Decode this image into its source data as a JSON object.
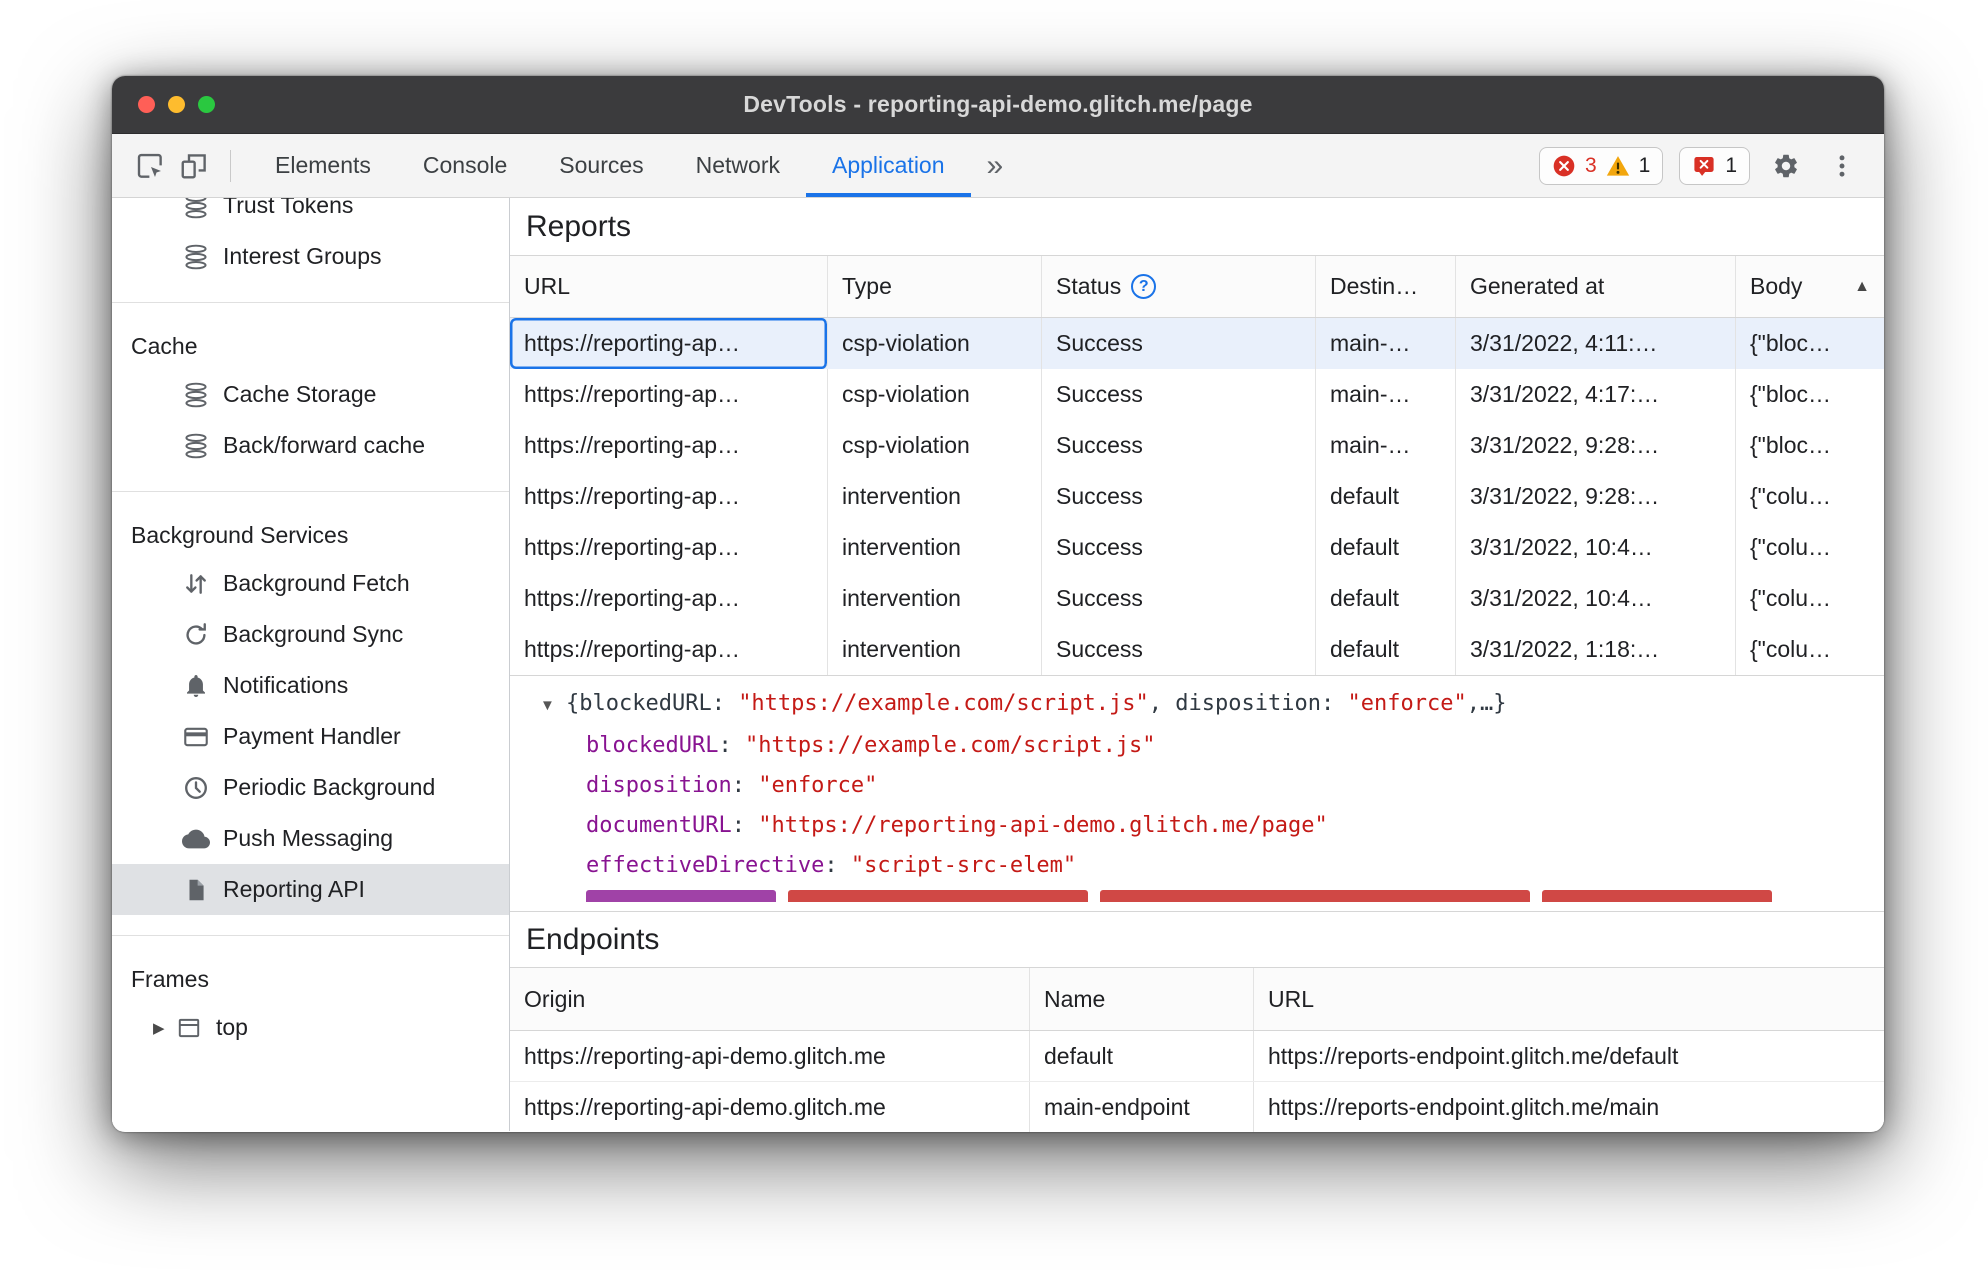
{
  "window": {
    "title": "DevTools - reporting-api-demo.glitch.me/page"
  },
  "icons": {
    "more_tabs": "»",
    "help": "?",
    "sort_asc": "▲",
    "expander": "▼",
    "disclosure": "▶"
  },
  "colors": {
    "accent": "#1a73e8",
    "error": "#d93025",
    "warning": "#f2a60d",
    "json_key": "#881391",
    "json_string": "#c41a16",
    "selected_row": "#e9f0fb",
    "titlebar": "#3b3b3d"
  },
  "toolbar": {
    "tabs": [
      "Elements",
      "Console",
      "Sources",
      "Network",
      "Application"
    ],
    "active_tab": "Application",
    "errors_count": "3",
    "warnings_count": "1",
    "issues_count": "1"
  },
  "sidebar": {
    "items": [
      "Trust Tokens",
      "Interest Groups",
      "Cache",
      "Cache Storage",
      "Back/forward cache",
      "Background Services",
      "Background Fetch",
      "Background Sync",
      "Notifications",
      "Payment Handler",
      "Periodic Background",
      "Push Messaging",
      "Reporting API",
      "Frames",
      "top"
    ],
    "selected_item": "Reporting API"
  },
  "reports": {
    "heading": "Reports",
    "columns": {
      "url": "URL",
      "type": "Type",
      "status": "Status",
      "destination": "Destin…",
      "generated": "Generated at",
      "body": "Body"
    },
    "rows": [
      {
        "url": "https://reporting-ap…",
        "type": "csp-violation",
        "status": "Success",
        "destination": "main-…",
        "generated": "3/31/2022, 4:11:…",
        "body": "{\"bloc…"
      },
      {
        "url": "https://reporting-ap…",
        "type": "csp-violation",
        "status": "Success",
        "destination": "main-…",
        "generated": "3/31/2022, 4:17:…",
        "body": "{\"bloc…"
      },
      {
        "url": "https://reporting-ap…",
        "type": "csp-violation",
        "status": "Success",
        "destination": "main-…",
        "generated": "3/31/2022, 9:28:…",
        "body": "{\"bloc…"
      },
      {
        "url": "https://reporting-ap…",
        "type": "intervention",
        "status": "Success",
        "destination": "default",
        "generated": "3/31/2022, 9:28:…",
        "body": "{\"colu…"
      },
      {
        "url": "https://reporting-ap…",
        "type": "intervention",
        "status": "Success",
        "destination": "default",
        "generated": "3/31/2022, 10:4…",
        "body": "{\"colu…"
      },
      {
        "url": "https://reporting-ap…",
        "type": "intervention",
        "status": "Success",
        "destination": "default",
        "generated": "3/31/2022, 10:4…",
        "body": "{\"colu…"
      },
      {
        "url": "https://reporting-ap…",
        "type": "intervention",
        "status": "Success",
        "destination": "default",
        "generated": "3/31/2022, 1:18:…",
        "body": "{\"colu…"
      }
    ]
  },
  "preview": {
    "colon": ": ",
    "summary": [
      {
        "t": "{blockedURL: "
      },
      {
        "t": "\"https://example.com/script.js\""
      },
      {
        "t": ", disposition: "
      },
      {
        "t": "\"enforce\""
      },
      {
        "t": ",…}"
      }
    ],
    "properties": [
      {
        "key": "blockedURL",
        "value": "\"https://example.com/script.js\""
      },
      {
        "key": "disposition",
        "value": "\"enforce\""
      },
      {
        "key": "documentURL",
        "value": "\"https://reporting-api-demo.glitch.me/page\""
      },
      {
        "key": "effectiveDirective",
        "value": "\"script-src-elem\""
      }
    ]
  },
  "endpoints": {
    "heading": "Endpoints",
    "columns": {
      "origin": "Origin",
      "name": "Name",
      "url": "URL"
    },
    "rows": [
      {
        "origin": "https://reporting-api-demo.glitch.me",
        "name": "default",
        "url": "https://reports-endpoint.glitch.me/default"
      },
      {
        "origin": "https://reporting-api-demo.glitch.me",
        "name": "main-endpoint",
        "url": "https://reports-endpoint.glitch.me/main"
      }
    ]
  }
}
